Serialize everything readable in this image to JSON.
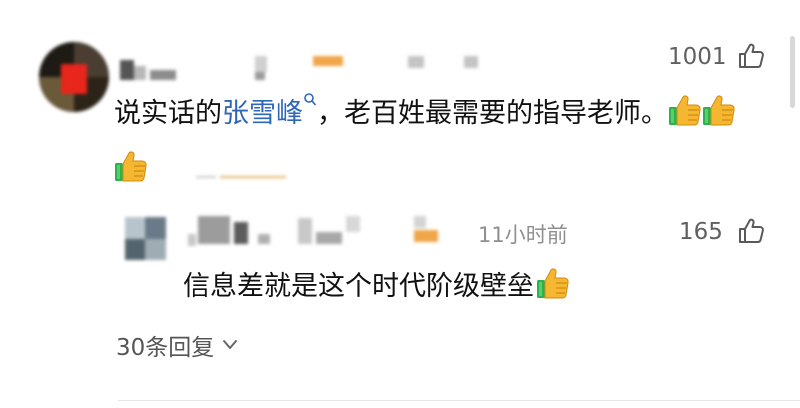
{
  "main_comment": {
    "likes": "1001",
    "text_before": "说实话的",
    "mention": "张雪峰",
    "text_after": "，老百姓最需要的指导老师。"
  },
  "reply": {
    "time": "11小时前",
    "likes": "165",
    "text": "信息差就是这个时代阶级壁垒"
  },
  "replies_link": {
    "label": "30条回复"
  },
  "icons": {
    "like": "thumb-up-outline-icon",
    "emoji": "thumbs-up-emoji",
    "expand": "chevron-down-icon",
    "mention": "search-icon"
  },
  "colors": {
    "mention": "#2f66b8",
    "meta_gray": "#8f8f8f",
    "emoji_yellow": "#f5b731",
    "emoji_green": "#2bb24c"
  }
}
